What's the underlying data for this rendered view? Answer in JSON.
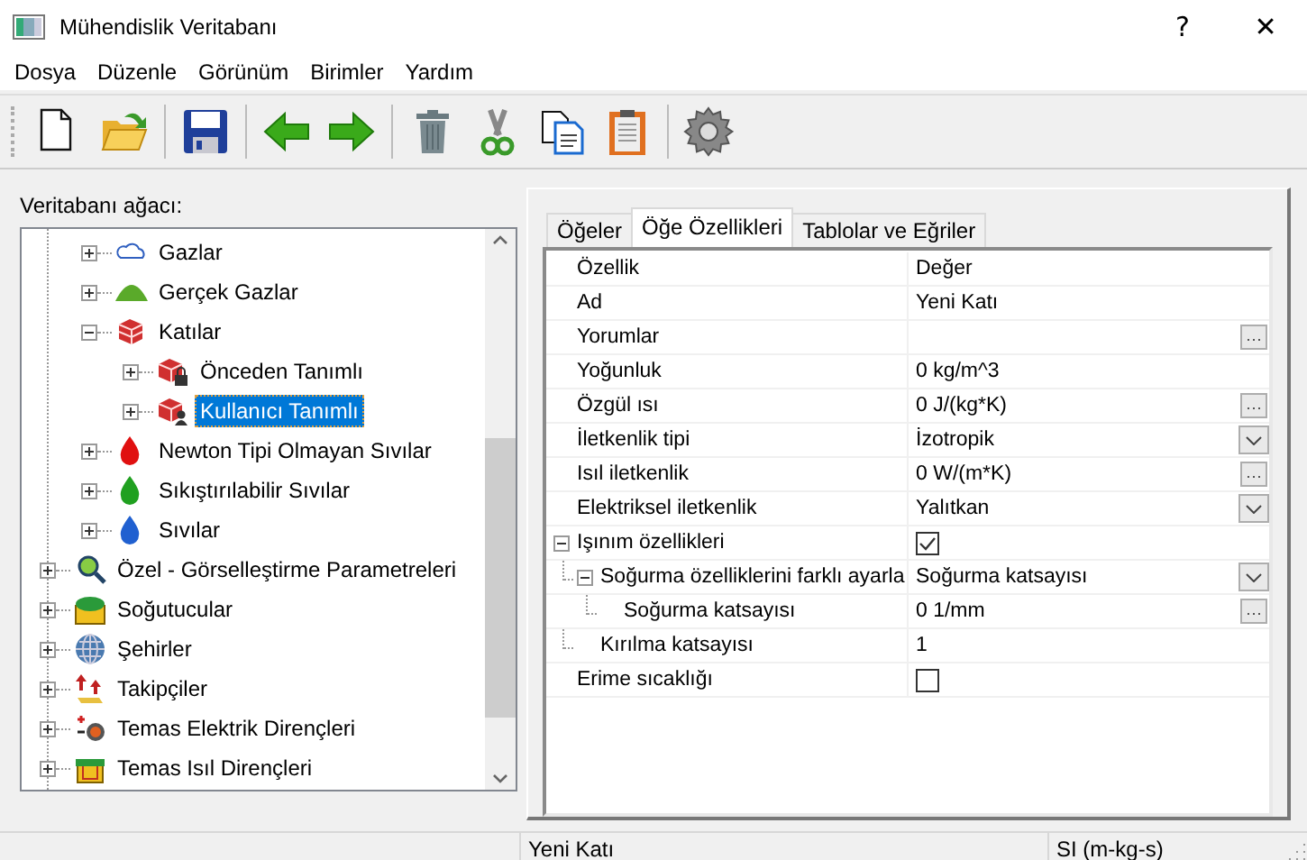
{
  "window": {
    "title": "Mühendislik Veritabanı",
    "buttons": [
      "?",
      "✕"
    ]
  },
  "menu": [
    "Dosya",
    "Düzenle",
    "Görünüm",
    "Birimler",
    "Yardım"
  ],
  "tree": {
    "label": "Veritabanı ağacı:",
    "continued_items": [
      {
        "label": "Gazlar",
        "expanded": false,
        "selected": false
      },
      {
        "label": "Gerçek Gazlar",
        "expanded": false,
        "selected": false
      },
      {
        "label": "Katılar",
        "expanded": true,
        "selected": false,
        "children": [
          {
            "label": "Önceden Tanımlı",
            "expanded": false,
            "selected": false
          },
          {
            "label": "Kullanıcı Tanımlı",
            "expanded": false,
            "selected": true
          }
        ]
      },
      {
        "label": "Newton Tipi Olmayan Sıvılar",
        "expanded": false,
        "selected": false
      },
      {
        "label": "Sıkıştırılabilir Sıvılar",
        "expanded": false,
        "selected": false
      },
      {
        "label": "Sıvılar",
        "expanded": false,
        "selected": false
      }
    ],
    "items": [
      {
        "label": "Özel - Görselleştirme Parametreleri",
        "expanded": false,
        "selected": false
      },
      {
        "label": "Soğutucular",
        "expanded": false,
        "selected": false
      },
      {
        "label": "Şehirler",
        "expanded": false,
        "selected": false
      },
      {
        "label": "Takipçiler",
        "expanded": false,
        "selected": false
      },
      {
        "label": "Temas Elektrik Dirençleri",
        "expanded": false,
        "selected": false
      },
      {
        "label": "Temas Isıl Dirençleri",
        "expanded": false,
        "selected": false
      }
    ]
  },
  "tabs": [
    {
      "label": "Öğeler",
      "selected": false
    },
    {
      "label": "Öğe Özellikleri",
      "selected": true
    },
    {
      "label": "Tablolar ve Eğriler",
      "selected": false
    }
  ],
  "properties": {
    "columns": [
      "Özellik",
      "Değer"
    ],
    "rows": [
      {
        "name": "Ad",
        "kind": "text",
        "value": "Yeni Katı"
      },
      {
        "name": "Yorumlar",
        "kind": "dialog"
      },
      {
        "name": "Yoğunluk",
        "kind": "text",
        "value": "0 kg/m^3"
      },
      {
        "name": "Özgül ısı",
        "kind": "dialog",
        "value": "0 J/(kg*K)"
      },
      {
        "name": "İletkenlik tipi",
        "kind": "dropdown",
        "value": "İzotropik"
      },
      {
        "name": "Isıl iletkenlik",
        "kind": "dialog",
        "value": "0 W/(m*K)"
      },
      {
        "name": "Elektriksel iletkenlik",
        "kind": "dropdown",
        "value": "Yalıtkan"
      },
      {
        "name": "Işınım özellikleri",
        "kind": "checkbox",
        "checked": true,
        "expanded": true,
        "children": [
          {
            "name": "Soğurma özelliklerini farklı ayarla",
            "kind": "dropdown",
            "value": "Soğurma katsayısı",
            "expanded": true,
            "children": [
              {
                "name": "Soğurma katsayısı",
                "kind": "dialog",
                "value": "0 1/mm"
              }
            ]
          },
          {
            "name": "Kırılma katsayısı",
            "kind": "text",
            "value": "1"
          }
        ]
      },
      {
        "name": "Erime sıcaklığı",
        "kind": "checkbox",
        "checked": false
      }
    ]
  },
  "status_bar": [
    "Yeni Katı",
    "SI (m-kg-s)"
  ]
}
